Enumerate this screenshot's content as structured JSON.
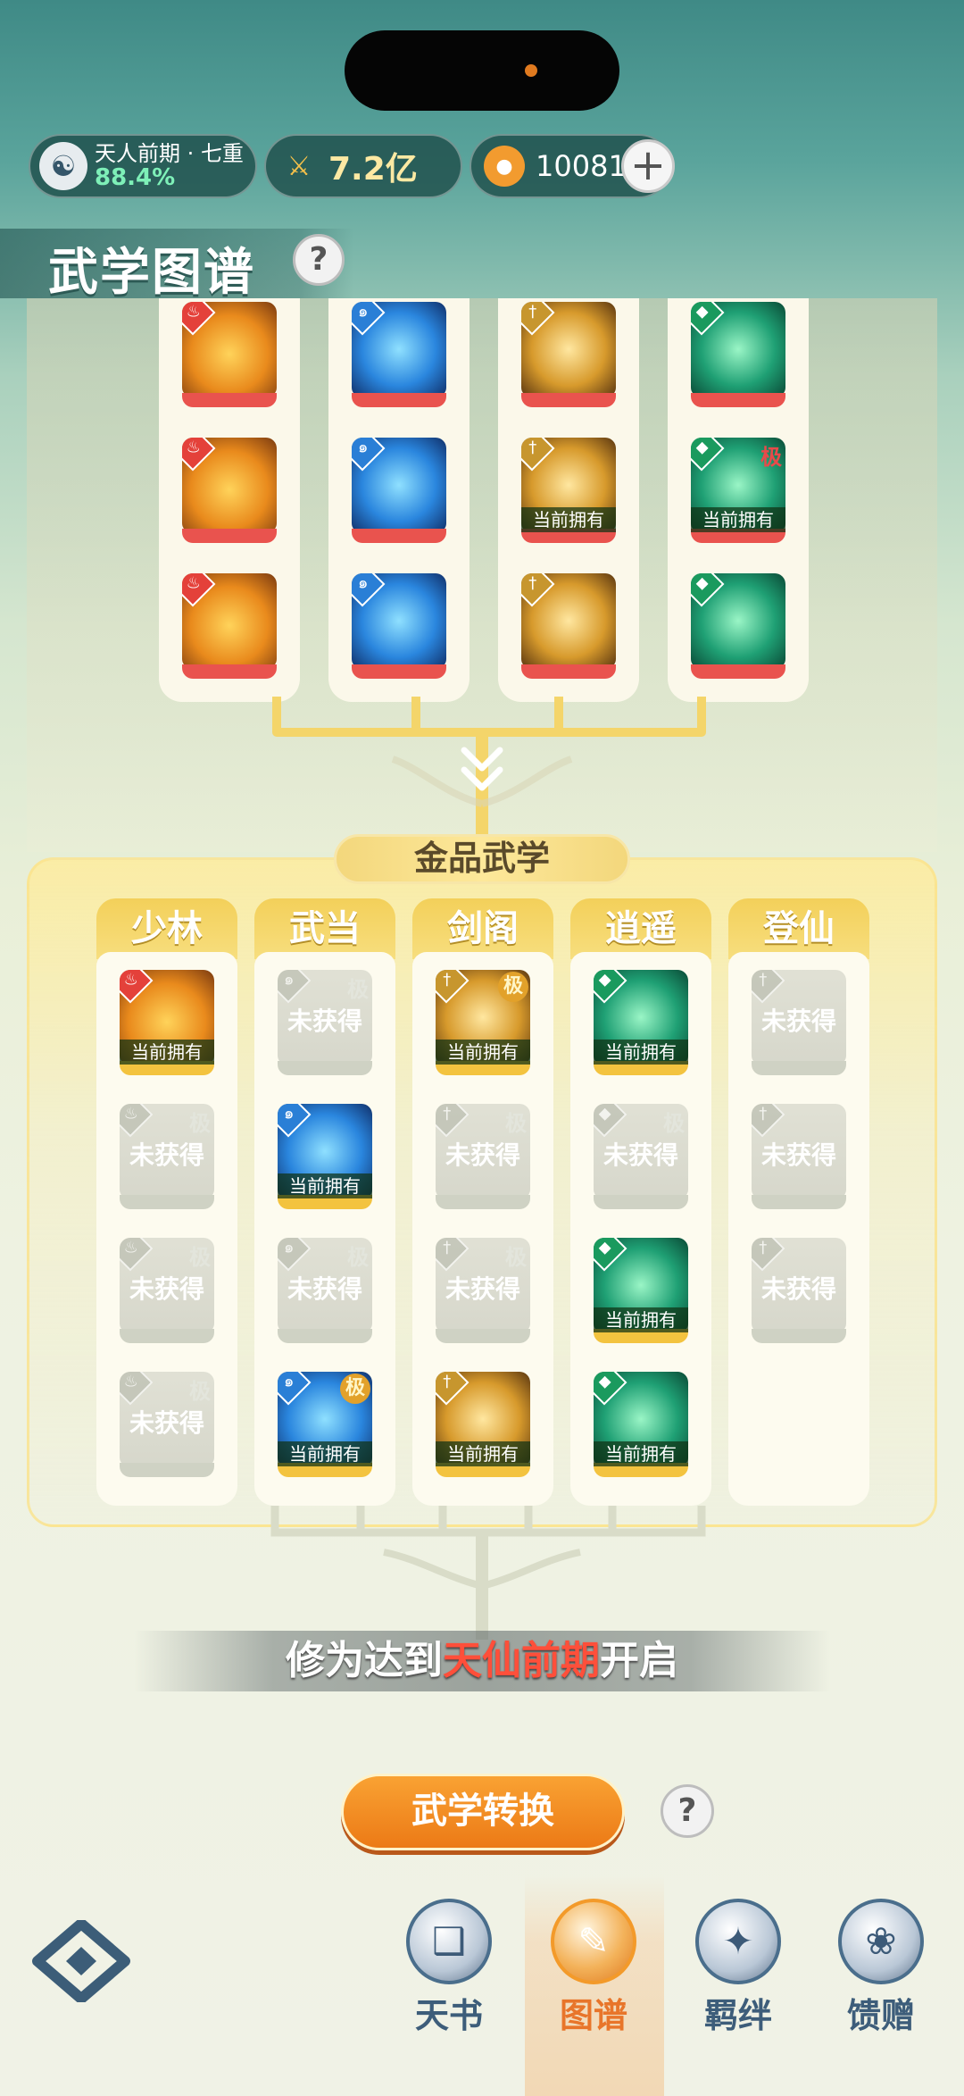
{
  "header": {
    "rank_name": "天人前期 · 七重",
    "rank_progress": "88.4%",
    "power_value": "7.2亿",
    "currency_value": "10081",
    "add_button": "+"
  },
  "page": {
    "title": "武学图谱",
    "help": "?"
  },
  "colors": {
    "fire": "#e4413a",
    "water": "#2a7fd6",
    "sword": "#c7962e",
    "wind": "#1a9a5e",
    "locked": "#9aa09a"
  },
  "upper_section": {
    "columns": [
      {
        "element": "fire",
        "skills": [
          {
            "owned_label": "",
            "grade": ""
          },
          {
            "owned_label": "",
            "grade": ""
          },
          {
            "owned_label": "",
            "grade": ""
          }
        ]
      },
      {
        "element": "water",
        "skills": [
          {
            "owned_label": "",
            "grade": ""
          },
          {
            "owned_label": "",
            "grade": ""
          },
          {
            "owned_label": "",
            "grade": ""
          }
        ]
      },
      {
        "element": "sword",
        "skills": [
          {
            "owned_label": "",
            "grade": ""
          },
          {
            "owned_label": "当前拥有",
            "grade": ""
          },
          {
            "owned_label": "",
            "grade": ""
          }
        ]
      },
      {
        "element": "wind",
        "skills": [
          {
            "owned_label": "",
            "grade": ""
          },
          {
            "owned_label": "当前拥有",
            "grade": "极"
          },
          {
            "owned_label": "",
            "grade": ""
          }
        ]
      }
    ]
  },
  "gold_section": {
    "title": "金品武学",
    "schools": [
      {
        "name": "少林",
        "skills": [
          {
            "state": "owned",
            "label": "当前拥有",
            "grade": ""
          },
          {
            "state": "locked",
            "label": "未获得",
            "grade": "极"
          },
          {
            "state": "locked",
            "label": "未获得",
            "grade": "极"
          },
          {
            "state": "locked",
            "label": "未获得",
            "grade": "极"
          }
        ]
      },
      {
        "name": "武当",
        "skills": [
          {
            "state": "locked",
            "label": "未获得",
            "grade": "极"
          },
          {
            "state": "owned",
            "label": "当前拥有",
            "grade": ""
          },
          {
            "state": "locked",
            "label": "未获得",
            "grade": "极"
          },
          {
            "state": "owned",
            "label": "当前拥有",
            "grade": "极"
          }
        ]
      },
      {
        "name": "剑阁",
        "skills": [
          {
            "state": "owned",
            "label": "当前拥有",
            "grade": "极"
          },
          {
            "state": "locked",
            "label": "未获得",
            "grade": "极"
          },
          {
            "state": "locked",
            "label": "未获得",
            "grade": "极"
          },
          {
            "state": "owned",
            "label": "当前拥有",
            "grade": ""
          }
        ]
      },
      {
        "name": "逍遥",
        "skills": [
          {
            "state": "owned",
            "label": "当前拥有",
            "grade": ""
          },
          {
            "state": "locked",
            "label": "未获得",
            "grade": "极"
          },
          {
            "state": "owned",
            "label": "当前拥有",
            "grade": ""
          },
          {
            "state": "owned",
            "label": "当前拥有",
            "grade": ""
          }
        ]
      },
      {
        "name": "登仙",
        "skills": [
          {
            "state": "locked",
            "label": "未获得",
            "grade": ""
          },
          {
            "state": "locked",
            "label": "未获得",
            "grade": ""
          },
          {
            "state": "locked",
            "label": "未获得",
            "grade": ""
          }
        ]
      }
    ]
  },
  "requirement": {
    "prefix": "修为达到",
    "highlight": "天仙前期",
    "suffix": "开启"
  },
  "convert_button": "武学转换",
  "convert_help": "?",
  "nav": [
    {
      "label": "天书",
      "icon": "book-icon",
      "active": false
    },
    {
      "label": "图谱",
      "icon": "map-scroll-icon",
      "active": true
    },
    {
      "label": "羁绊",
      "icon": "handshake-icon",
      "active": false
    },
    {
      "label": "馈赠",
      "icon": "gift-icon",
      "active": false
    }
  ]
}
